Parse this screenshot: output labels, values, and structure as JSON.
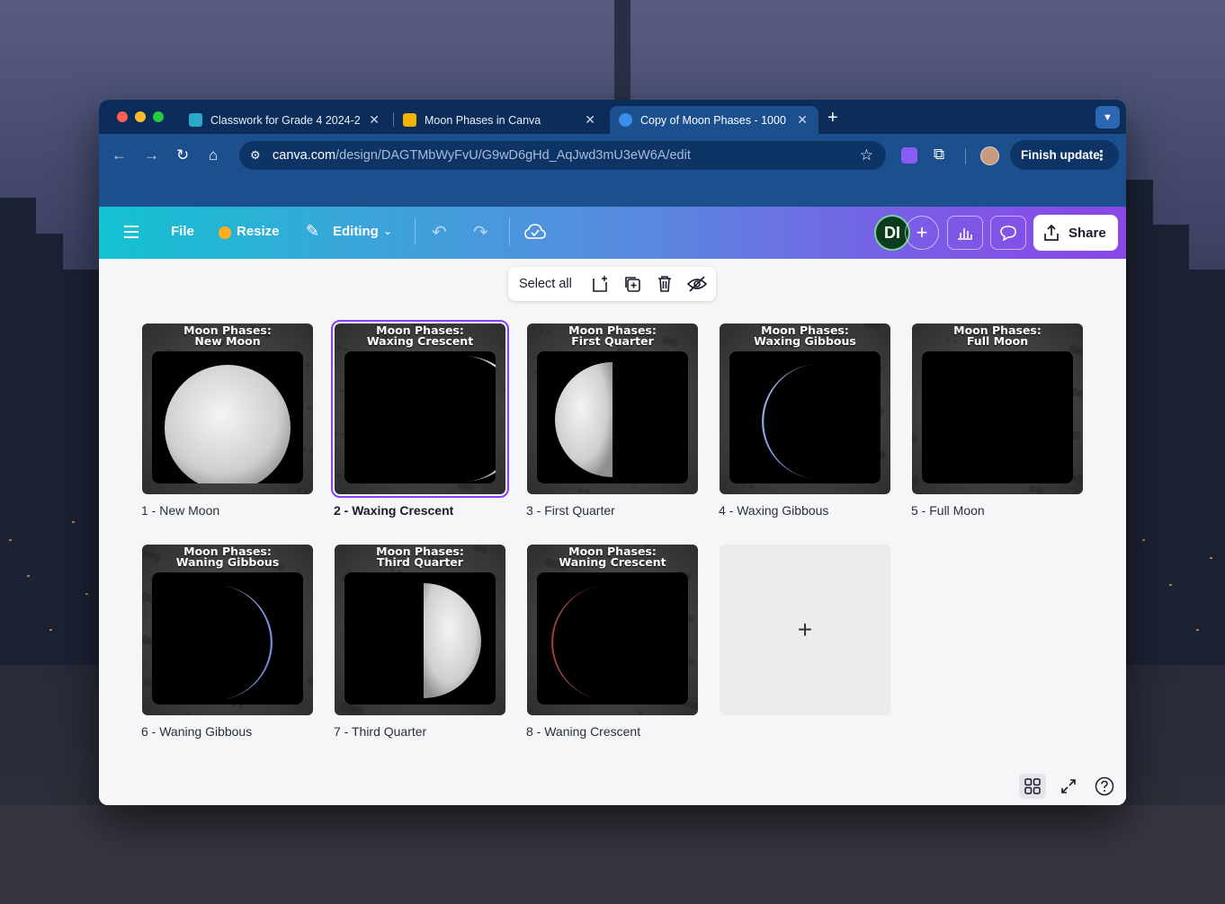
{
  "browser": {
    "tabs": [
      {
        "title": "Classwork for Grade 4 2024-2",
        "color": "#2aa7c9"
      },
      {
        "title": "Moon Phases in Canva",
        "color": "#f2b400"
      },
      {
        "title": "Copy of Moon Phases - 1000",
        "color": "#3a8ee8",
        "active": true
      }
    ],
    "url_host": "canva.com",
    "url_path": "/design/DAGTMbWyFvU/G9wD6gHd_AqJwd3mU3eW6A/edit",
    "finish_update": "Finish update"
  },
  "canva": {
    "menu_file": "File",
    "menu_resize": "Resize",
    "menu_editing": "Editing",
    "avatar_initials": "DI",
    "share_label": "Share",
    "select_all": "Select all"
  },
  "pages": [
    {
      "title_line1": "Moon Phases:",
      "title_line2": "New Moon",
      "label": "1 - New Moon",
      "phase": "full-white"
    },
    {
      "title_line1": "Moon Phases:",
      "title_line2": "Waxing Crescent",
      "label": "2 - Waxing Crescent",
      "phase": "crescent-right",
      "selected": true
    },
    {
      "title_line1": "Moon Phases:",
      "title_line2": "First Quarter",
      "label": "3 - First Quarter",
      "phase": "half-left"
    },
    {
      "title_line1": "Moon Phases:",
      "title_line2": "Waxing Gibbous",
      "label": "4 - Waxing Gibbous",
      "phase": "crescent-left-blue"
    },
    {
      "title_line1": "Moon Phases:",
      "title_line2": "Full Moon",
      "label": "5 - Full Moon",
      "phase": "none"
    },
    {
      "title_line1": "Moon Phases:",
      "title_line2": "Waning Gibbous",
      "label": "6 - Waning Gibbous",
      "phase": "crescent-right-blue"
    },
    {
      "title_line1": "Moon Phases:",
      "title_line2": "Third Quarter",
      "label": "7 - Third Quarter",
      "phase": "half-right"
    },
    {
      "title_line1": "Moon Phases:",
      "title_line2": "Waning Crescent",
      "label": "8 - Waning Crescent",
      "phase": "crescent-left-red"
    }
  ],
  "add_page_symbol": "+"
}
